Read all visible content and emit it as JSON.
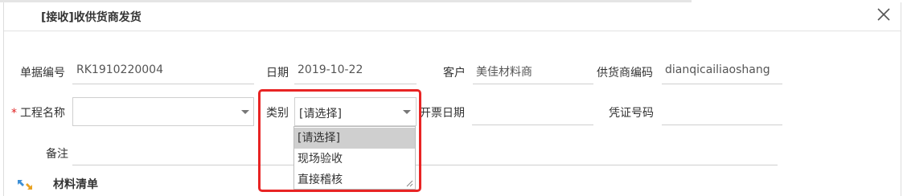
{
  "dialog": {
    "title": "[接收]收供货商发货"
  },
  "fields": {
    "doc_no": {
      "label": "单据编号",
      "value": "RK1910220004"
    },
    "date": {
      "label": "日期",
      "value": "2019-10-22"
    },
    "customer": {
      "label": "客户",
      "value": "美佳材料商"
    },
    "supplier_code": {
      "label": "供货商编码",
      "value": "dianqicailiaoshang"
    },
    "project": {
      "label": "工程名称",
      "required_mark": "*",
      "value": ""
    },
    "category": {
      "label": "类别",
      "value": "[请选择]"
    },
    "invoice_date": {
      "label": "开票日期",
      "value": ""
    },
    "voucher_no": {
      "label": "凭证号码",
      "value": ""
    },
    "remark": {
      "label": "备注",
      "value": ""
    }
  },
  "category_dropdown": {
    "options": [
      "[请选择]",
      "现场验收",
      "直接稽核"
    ],
    "selected_index": 0
  },
  "section": {
    "title": "材料清单"
  },
  "colors": {
    "highlight": "#e82424",
    "required": "#e02020",
    "selected_option": "#cfcfcf"
  },
  "icons": {
    "close": "close-icon",
    "caret": "chevron-down-icon",
    "materials": "arrows-icon"
  }
}
